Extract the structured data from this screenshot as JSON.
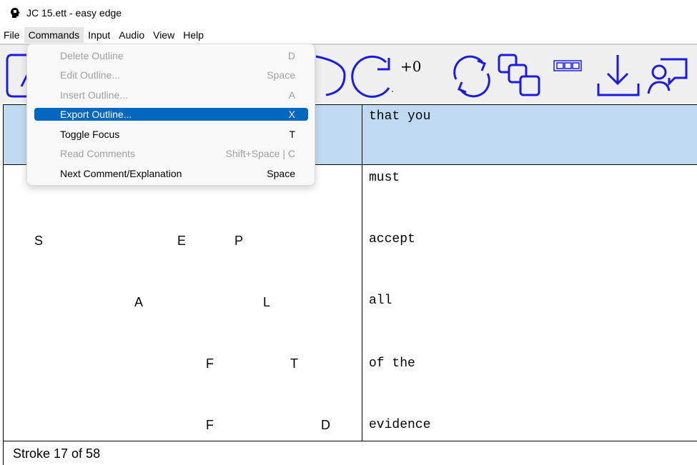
{
  "window": {
    "title": "JC 15.ett - easy edge",
    "app_icon": "head-icon"
  },
  "menubar": {
    "items": [
      "File",
      "Commands",
      "Input",
      "Audio",
      "View",
      "Help"
    ],
    "active": "Commands"
  },
  "toolbar": {
    "icons": [
      "outline-icon",
      "rotate-ccw-icon",
      "rotate-cw-icon",
      "sync-icon",
      "copy-windows-icon",
      "grid-boxes-icon",
      "download-icon",
      "comment-person-icon"
    ],
    "offset_label": "+0",
    "color": "#1c1ce0"
  },
  "commands_menu": {
    "items": [
      {
        "label": "Delete Outline",
        "shortcut": "D",
        "enabled": false
      },
      {
        "label": "Edit Outline...",
        "shortcut": "Space",
        "enabled": false
      },
      {
        "label": "Insert Outline...",
        "shortcut": "A",
        "enabled": false
      },
      {
        "label": "Export Outline...",
        "shortcut": "X",
        "enabled": true,
        "selected": true
      },
      {
        "label": "Toggle Focus",
        "shortcut": "T",
        "enabled": true
      },
      {
        "label": "Read Comments",
        "shortcut": "Shift+Space | C",
        "enabled": false
      },
      {
        "label": "Next Comment/Explanation",
        "shortcut": "Space",
        "enabled": true
      }
    ]
  },
  "grid": {
    "rows": [
      {
        "keys": [],
        "text": "that you",
        "highlighted": true
      },
      {
        "keys": [],
        "text": "must"
      },
      {
        "keys": [
          "S",
          "E",
          "P"
        ],
        "text": "accept"
      },
      {
        "keys": [
          "A",
          "L"
        ],
        "text": "all"
      },
      {
        "keys": [
          "F",
          "T"
        ],
        "text": "of the"
      },
      {
        "keys": [
          "F",
          "D"
        ],
        "text": "evidence"
      }
    ],
    "highlight_color": "#c0dbf1"
  },
  "status": {
    "text": "Stroke 17 of 58"
  }
}
